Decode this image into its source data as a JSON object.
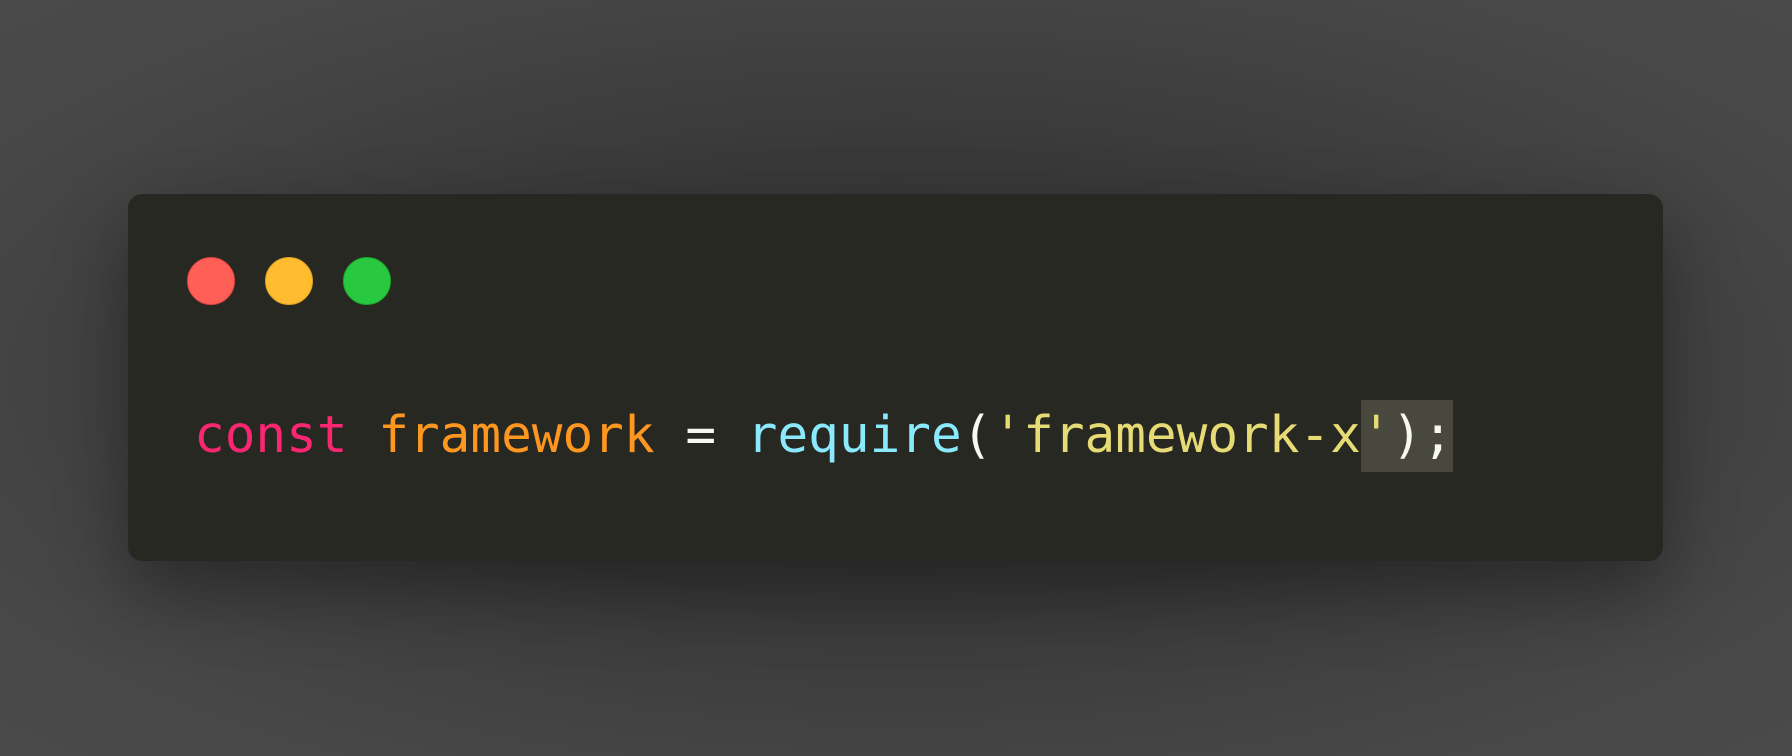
{
  "window": {
    "controls": {
      "close_color": "#ff5f57",
      "minimize_color": "#febc2e",
      "maximize_color": "#28c840"
    }
  },
  "code": {
    "line1": {
      "keyword": "const",
      "variable": "framework",
      "operator": "=",
      "function": "require",
      "open_paren": "(",
      "string_body": "'framework-x",
      "string_close": "'",
      "close_paren": ")",
      "semicolon": ";"
    }
  },
  "colors": {
    "background": "#3a3a3a",
    "editor_background": "#282823",
    "keyword": "#f92672",
    "variable": "#fd971f",
    "function": "#8be9fd",
    "string": "#e6db74",
    "text": "#f8f8f2",
    "selection": "#49483e"
  }
}
